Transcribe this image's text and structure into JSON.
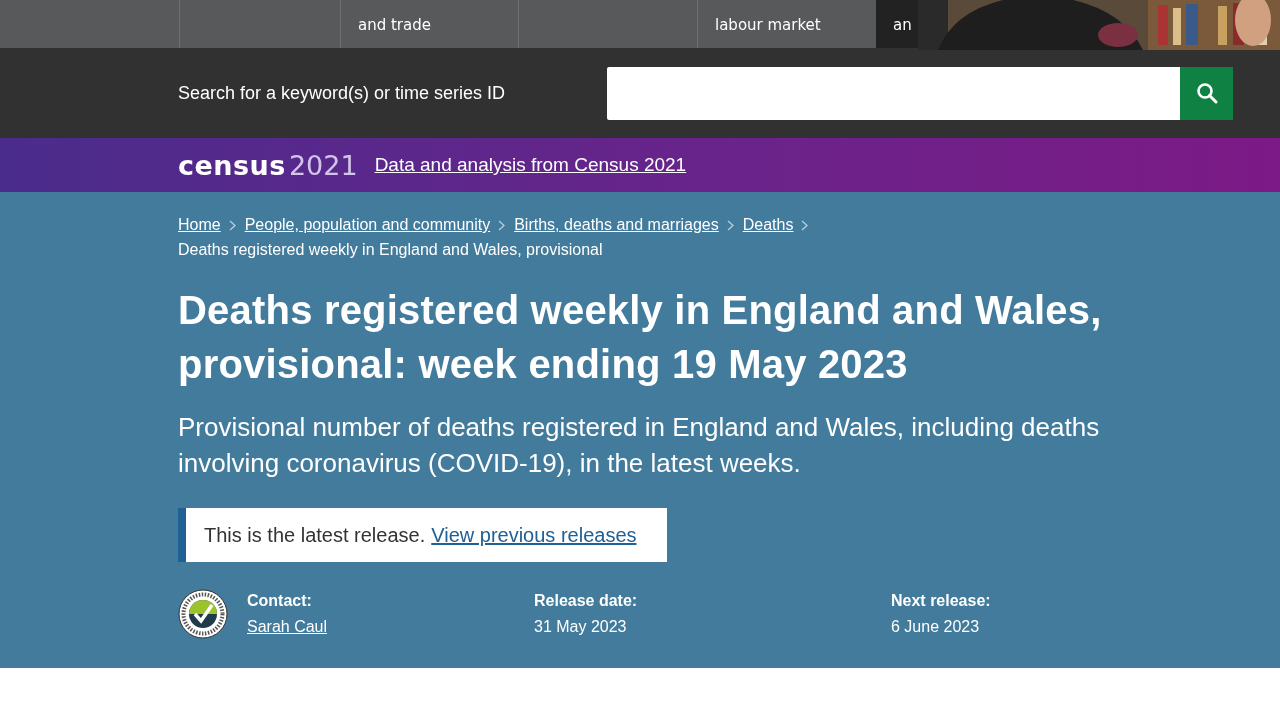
{
  "nav": {
    "tabs": [
      {
        "selected": false
      },
      {
        "label": "and trade",
        "selected": false
      },
      {
        "selected": false
      },
      {
        "label": "labour market",
        "selected": false
      },
      {
        "label": "an",
        "selected": true
      }
    ]
  },
  "search": {
    "label": "Search for a keyword(s) or time series ID"
  },
  "census_banner": {
    "logo_word": "census",
    "logo_year": "2021",
    "link": "Data and analysis from Census 2021"
  },
  "breadcrumbs": [
    {
      "label": "Home"
    },
    {
      "label": "People, population and community"
    },
    {
      "label": "Births, deaths and marriages"
    },
    {
      "label": "Deaths"
    }
  ],
  "breadcrumb_current": "Deaths registered weekly in England and Wales, provisional",
  "title": "Deaths registered weekly in England and Wales, provisional: week ending 19 May 2023",
  "summary": "Provisional number of deaths registered in England and Wales, including deaths involving coronavirus (COVID-19), in the latest weeks.",
  "notice": {
    "text": "This is the latest release.",
    "link": "View previous releases"
  },
  "meta": [
    {
      "label": "Contact:",
      "value": "Sarah Caul",
      "kind": "link"
    },
    {
      "label": "Release date:",
      "value": "31 May 2023",
      "kind": "text"
    },
    {
      "label": "Next release:",
      "value": "6 June 2023",
      "kind": "text"
    }
  ]
}
